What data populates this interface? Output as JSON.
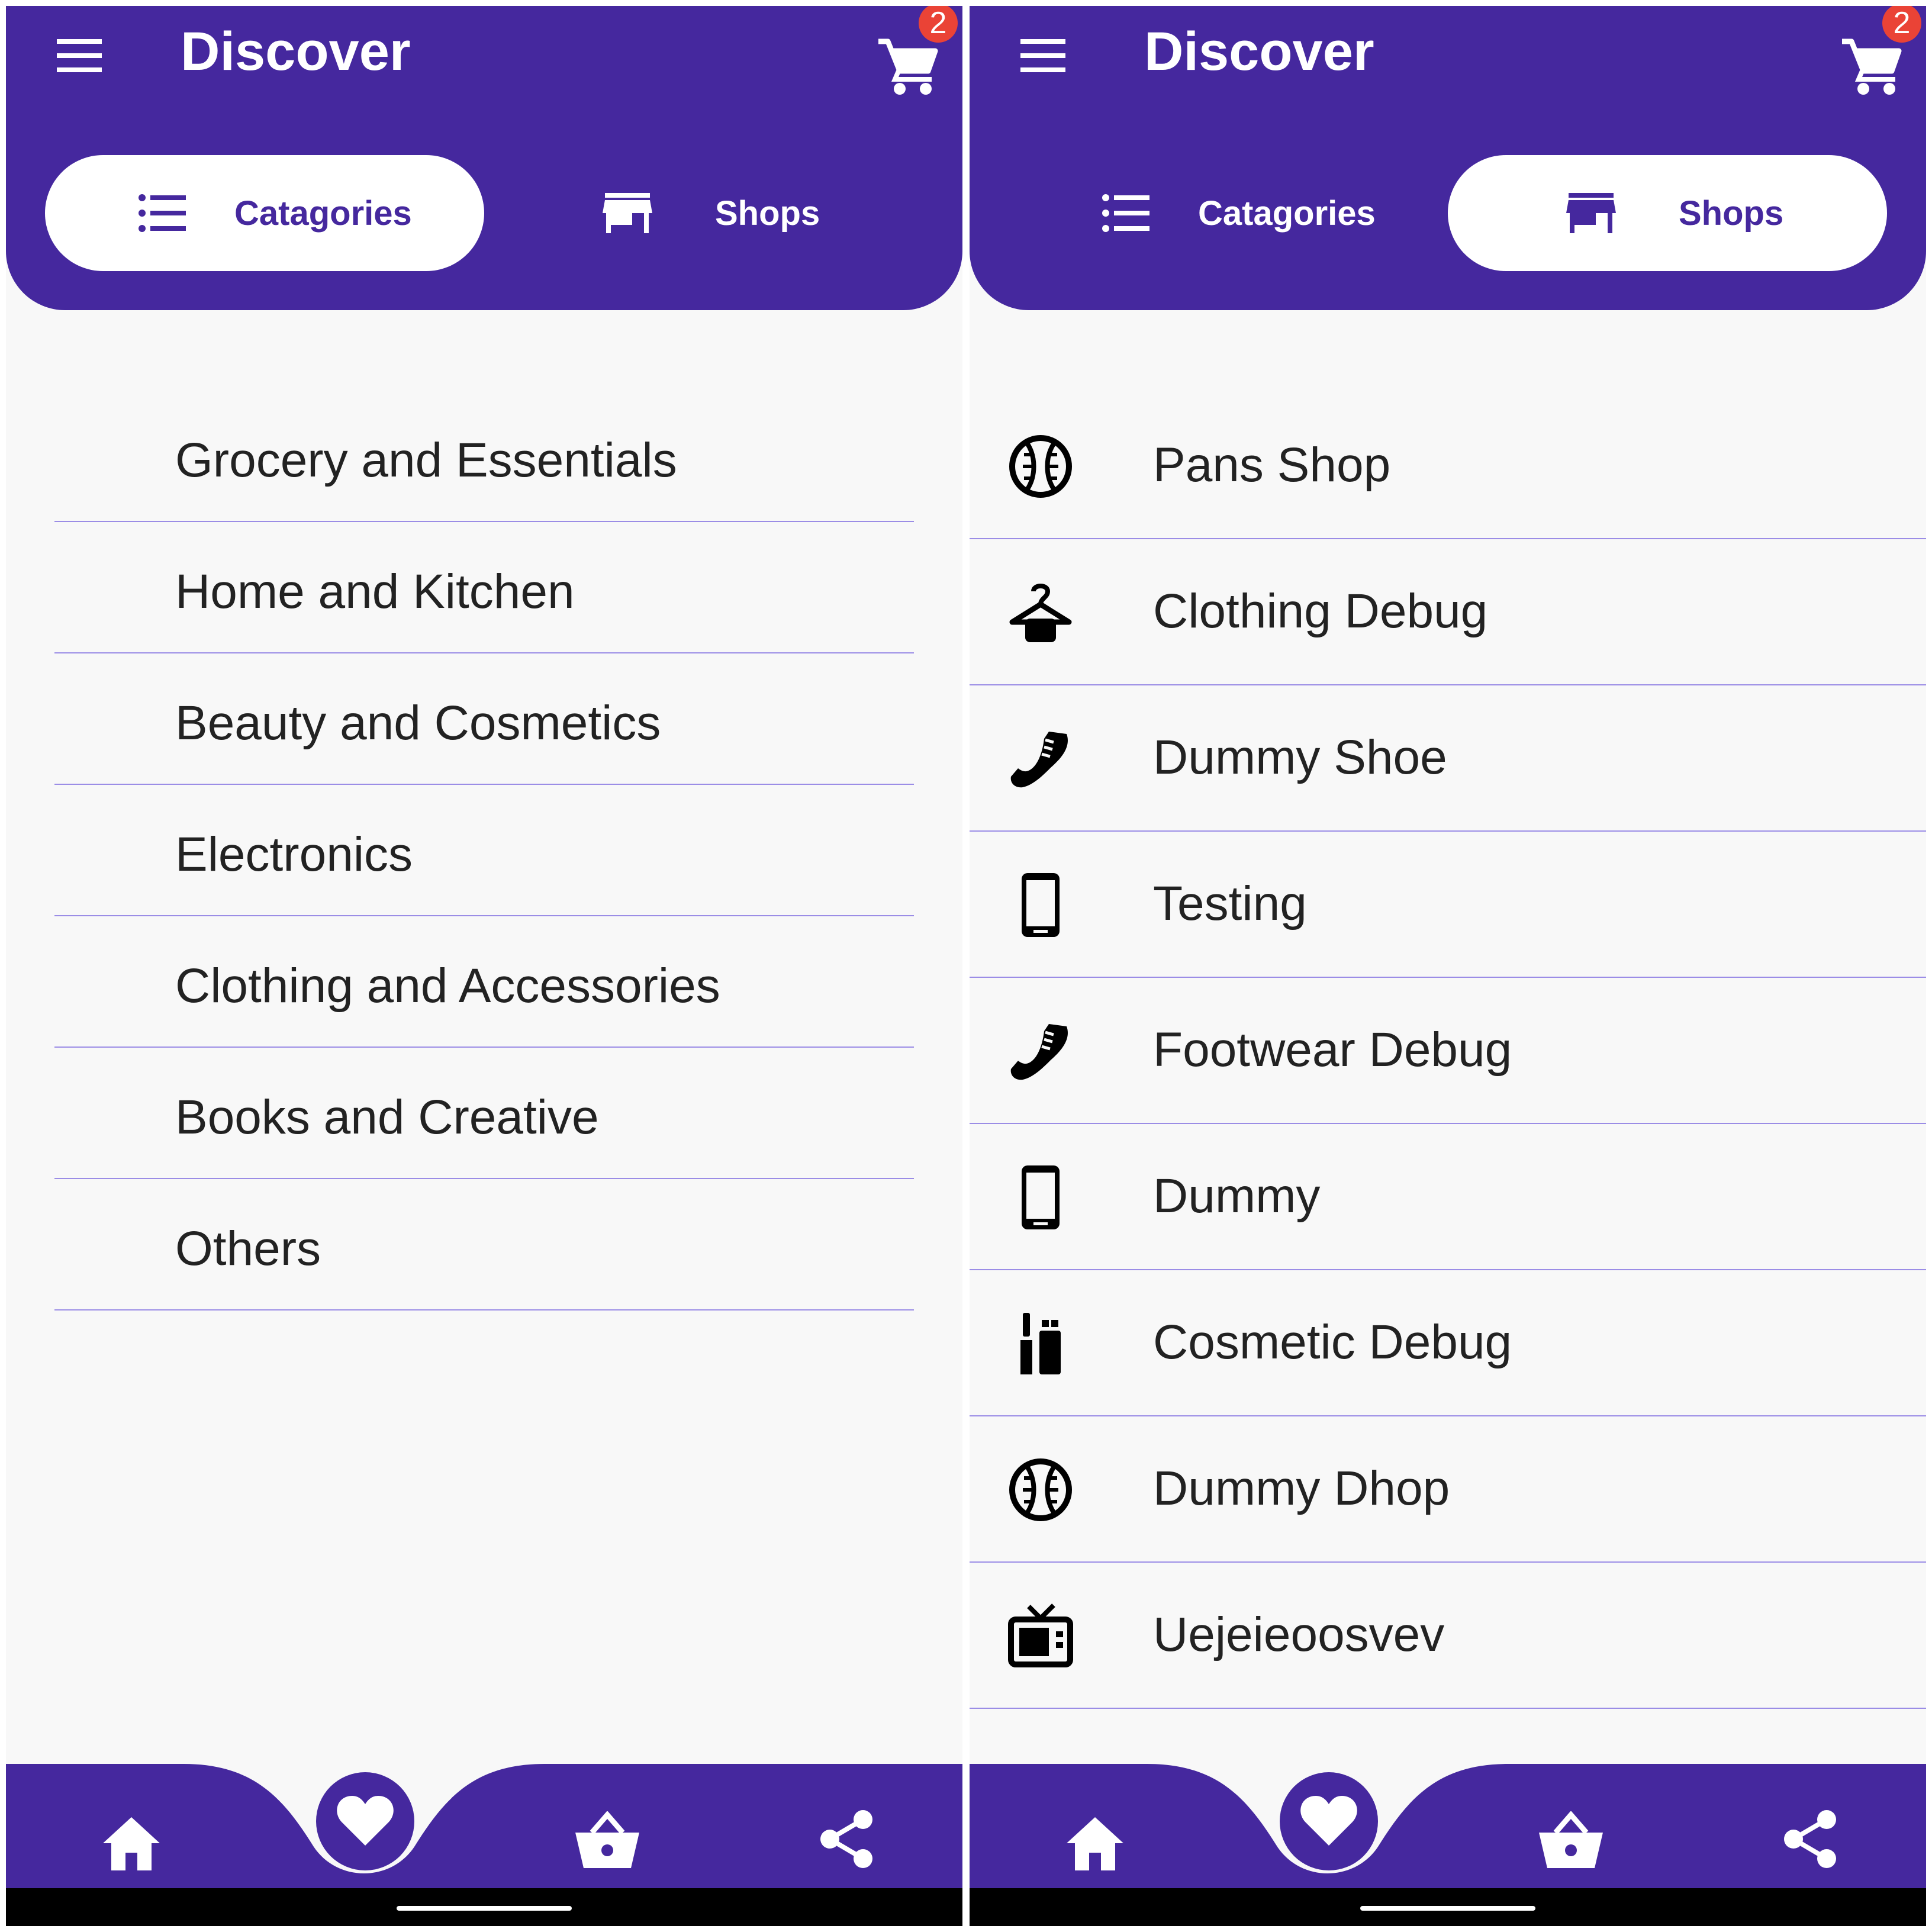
{
  "colors": {
    "brand": "#45289e",
    "badge": "#ea4336",
    "divider": "#9b8de6",
    "background": "#f8f8f8",
    "text": "#222222"
  },
  "left": {
    "header": {
      "title": "Discover",
      "cart_count": "2",
      "icons": {
        "menu": "menu-icon",
        "cart": "cart-icon"
      }
    },
    "tabs": [
      {
        "label": "Catagories",
        "icon": "list-icon",
        "active": true
      },
      {
        "label": "Shops",
        "icon": "storefront-icon",
        "active": false
      }
    ],
    "categories": [
      "Grocery and Essentials",
      "Home and Kitchen",
      "Beauty and Cosmetics",
      "Electronics",
      "Clothing and Accessories",
      "Books and Creative",
      "Others"
    ],
    "bottom_nav": [
      "home-icon",
      "heart-icon",
      "basket-icon",
      "share-icon"
    ]
  },
  "right": {
    "header": {
      "title": "Discover",
      "cart_count": "2",
      "icons": {
        "menu": "menu-icon",
        "cart": "cart-icon"
      }
    },
    "tabs": [
      {
        "label": "Catagories",
        "icon": "list-icon",
        "active": false
      },
      {
        "label": "Shops",
        "icon": "storefront-icon",
        "active": true
      }
    ],
    "shops": [
      {
        "name": "Pans Shop",
        "icon": "baseball-icon"
      },
      {
        "name": "Clothing Debug",
        "icon": "hanger-icon"
      },
      {
        "name": "Dummy Shoe",
        "icon": "shoe-icon"
      },
      {
        "name": "Testing",
        "icon": "smartphone-icon"
      },
      {
        "name": "Footwear Debug",
        "icon": "shoe-icon"
      },
      {
        "name": "Dummy",
        "icon": "smartphone-icon"
      },
      {
        "name": "Cosmetic Debug",
        "icon": "cosmetics-icon"
      },
      {
        "name": "Dummy Dhop",
        "icon": "baseball-icon"
      },
      {
        "name": "Uejeieoosvev",
        "icon": "tv-icon"
      }
    ],
    "bottom_nav": [
      "home-icon",
      "heart-icon",
      "basket-icon",
      "share-icon"
    ]
  }
}
